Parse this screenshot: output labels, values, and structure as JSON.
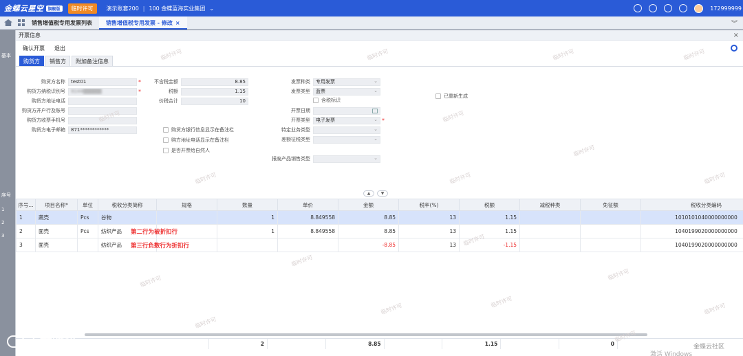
{
  "topbar": {
    "brand": "金蝶云星空",
    "brand_badge": "旗舰版",
    "temp_license": "临时许可",
    "account": "演示账套200",
    "org": "100 金蝶蓝海实业集团",
    "user_id": "172999999"
  },
  "tabs": [
    {
      "label": "销售增值税专用发票列表"
    },
    {
      "label": "销售增值税专用发票 - 修改"
    }
  ],
  "left_strip": {
    "label_a": "基本",
    "label_b": "序号",
    "rows": [
      "1",
      "2",
      "3"
    ]
  },
  "dialog": {
    "title": "开票信息",
    "toolbar": {
      "confirm": "确认开票",
      "exit": "退出"
    },
    "subtabs": [
      "购货方",
      "销售方",
      "附加备注信息"
    ],
    "buyer": {
      "name_label": "购货方名称",
      "name_value": "test01",
      "taxid_label": "购货方纳税识别号",
      "taxid_value": "9144▒▒▒▒▒",
      "addr_label": "购货方地址电话",
      "addr_value": "",
      "bank_label": "购货方开户行及账号",
      "bank_value": "",
      "phone_label": "购货方收票手机号",
      "phone_value": "",
      "email_label": "购货方电子邮箱",
      "email_value": "871************"
    },
    "amounts": {
      "untaxed_label": "不含税金额",
      "untaxed_value": "8.85",
      "tax_label": "税额",
      "tax_value": "1.15",
      "total_label": "价税合计",
      "total_value": "10"
    },
    "checks": {
      "bank_note": "购货方银行信息显示在备注栏",
      "addr_note": "购方地址电话显示在备注栏",
      "natural_person": "是否开票给自然人",
      "tax_included": "含税标识",
      "regenerated": "已重新生成"
    },
    "invoice": {
      "kind_label": "发票种类",
      "kind_value": "专用发票",
      "type_label": "发票类型",
      "type_value": "蓝票",
      "date_label": "开票日期",
      "date_value": "",
      "issue_label": "开票类型",
      "issue_value": "电子发票",
      "special_label": "特定业务类型",
      "special_value": "",
      "diff_label": "差额征税类型",
      "diff_value": "",
      "report_label": "报废产品销售类型",
      "report_value": ""
    }
  },
  "table": {
    "headers": [
      "序号...",
      "项目名称*",
      "单位",
      "税收分类简称",
      "规格",
      "数量",
      "单价",
      "金额",
      "税率(%)",
      "税额",
      "减税种类",
      "免征额",
      "税收分类编码"
    ],
    "rows": [
      {
        "no": "1",
        "name": "蔬壳",
        "unit": "Pcs",
        "cat": "谷物",
        "note": "",
        "qty": "1",
        "price": "8.849558",
        "amount": "8.85",
        "rate": "13",
        "tax": "1.15",
        "code": "1010101040000000000"
      },
      {
        "no": "2",
        "name": "面壳",
        "unit": "Pcs",
        "cat": "纺织产品",
        "note": "第二行为被折扣行",
        "qty": "1",
        "price": "8.849558",
        "amount": "8.85",
        "rate": "13",
        "tax": "1.15",
        "code": "1040199020000000000"
      },
      {
        "no": "3",
        "name": "面壳",
        "unit": "",
        "cat": "纺织产品",
        "note": "第三行负数行为折扣行",
        "qty": "",
        "price": "",
        "amount": "-8.85",
        "rate": "13",
        "tax": "-1.15",
        "code": "1040199020000000000"
      }
    ],
    "totals": {
      "qty": "2",
      "amount": "8.85",
      "tax": "1.15",
      "exempt": "0"
    }
  },
  "watermarks": {
    "temp": "临时许可",
    "logo": "大数跨境",
    "community": "金蝶云社区",
    "windows": "激活 Windows"
  },
  "colors": {
    "primary": "#2a5bd7",
    "license": "#f08a24",
    "negative": "#e33333"
  }
}
